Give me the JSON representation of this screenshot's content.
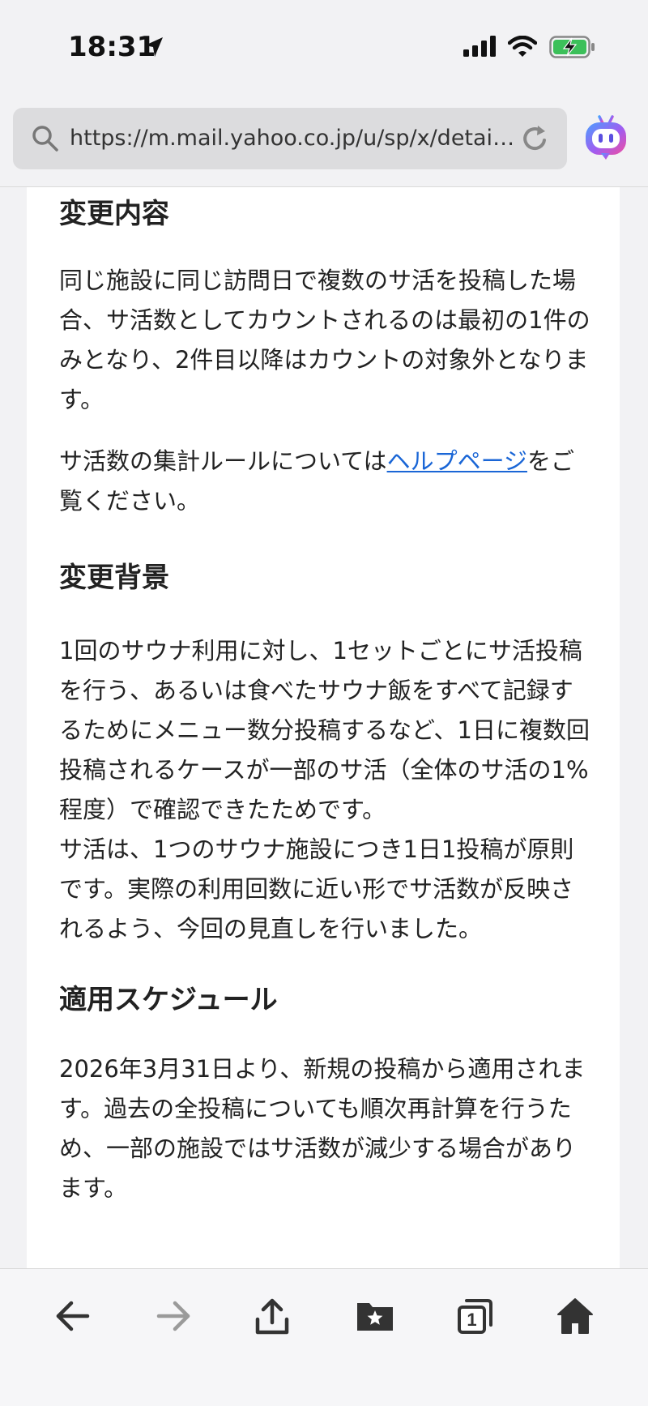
{
  "status_bar": {
    "time": "18:31"
  },
  "browser": {
    "url": "https://m.mail.yahoo.co.jp/u/sp/x/detail/..."
  },
  "content": {
    "section1": {
      "heading": "変更内容",
      "p1": "同じ施設に同じ訪問日で複数のサ活を投稿した場合、サ活数としてカウントされるのは最初の1件のみとなり、2件目以降はカウントの対象外となります。",
      "p2_before": "サ活数の集計ルールについては",
      "p2_link": "ヘルプページ",
      "p2_after": "をご覧ください。"
    },
    "section2": {
      "heading": "変更背景",
      "p1": "1回のサウナ利用に対し、1セットごとにサ活投稿を行う、あるいは食べたサウナ飯をすべて記録するためにメニュー数分投稿するなど、1日に複数回投稿されるケースが一部のサ活（全体のサ活の1%程度）で確認できたためです。",
      "p2": "サ活は、1つのサウナ施設につき1日1投稿が原則です。実際の利用回数に近い形でサ活数が反映されるよう、今回の見直しを行いました。"
    },
    "section3": {
      "heading": "適用スケジュール",
      "p1": "2026年3月31日より、新規の投稿から適用されます。過去の全投稿についても順次再計算を行うため、一部の施設ではサ活数が減少する場合があります。"
    }
  },
  "toolbar": {
    "tabs_count": "1",
    "icons": [
      "back-arrow-icon",
      "forward-arrow-icon",
      "share-icon",
      "bookmarks-folder-icon",
      "tabs-icon",
      "home-icon"
    ]
  }
}
